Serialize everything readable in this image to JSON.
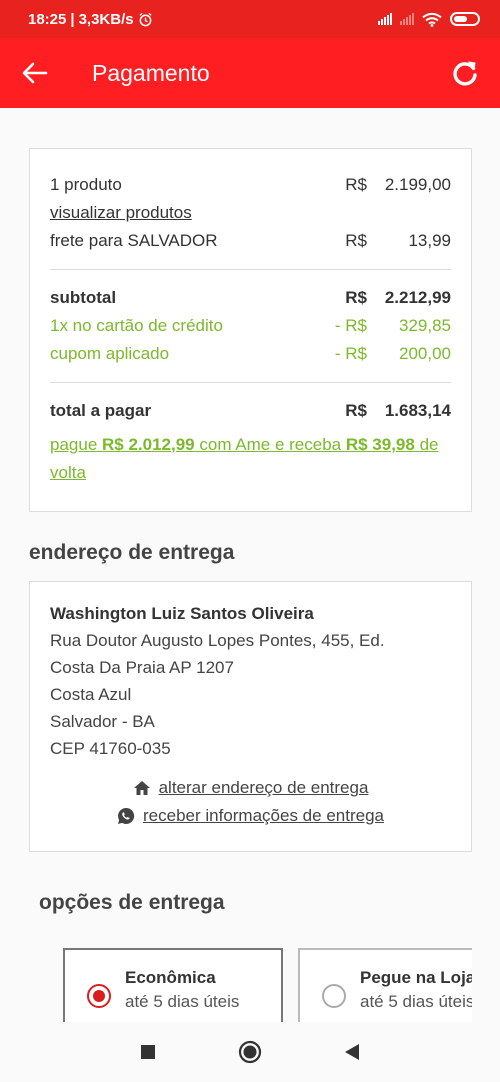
{
  "status_bar": {
    "time": "18:25",
    "speed": "3,3KB/s"
  },
  "app_bar": {
    "title": "Pagamento"
  },
  "summary": {
    "products": {
      "label": "1 produto",
      "currency": "R$",
      "value": "2.199,00"
    },
    "view_products": "visualizar produtos",
    "shipping": {
      "label": "frete para SALVADOR",
      "currency": "R$",
      "value": "13,99"
    },
    "subtotal": {
      "label": "subtotal",
      "currency": "R$",
      "value": "2.212,99"
    },
    "card_discount": {
      "label": "1x no cartão de crédito",
      "currency": "- R$",
      "value": "329,85"
    },
    "coupon": {
      "label": "cupom aplicado",
      "currency": "- R$",
      "value": "200,00"
    },
    "total": {
      "label": "total a pagar",
      "currency": "R$",
      "value": "1.683,14"
    },
    "ame_offer": {
      "prefix": "pague ",
      "amount": "R$ 2.012,99",
      "middle": " com Ame e receba ",
      "cashback_cur": "R$",
      "cashback_value": "39,98",
      "suffix": " de volta"
    }
  },
  "address_section": {
    "title": "endereço de entrega",
    "name": "Washington Luiz Santos Oliveira",
    "line1": "Rua Doutor Augusto Lopes Pontes, 455, Ed.",
    "line2": "Costa Da Praia AP 1207",
    "line3": "Costa Azul",
    "line4": "Salvador - BA",
    "cep": "CEP 41760-035",
    "change_link": "alterar endereço de entrega",
    "whatsapp_link": "receber informações de entrega"
  },
  "delivery_section": {
    "title": "opções de entrega",
    "options": [
      {
        "name": "Econômica",
        "eta": "até 5 dias úteis",
        "selected": true
      },
      {
        "name": "Pegue na Loja",
        "eta": "até 5 dias úteis",
        "selected": false
      }
    ]
  },
  "colors": {
    "brand": "#ff1f23",
    "accent_green": "#7cb92d"
  }
}
